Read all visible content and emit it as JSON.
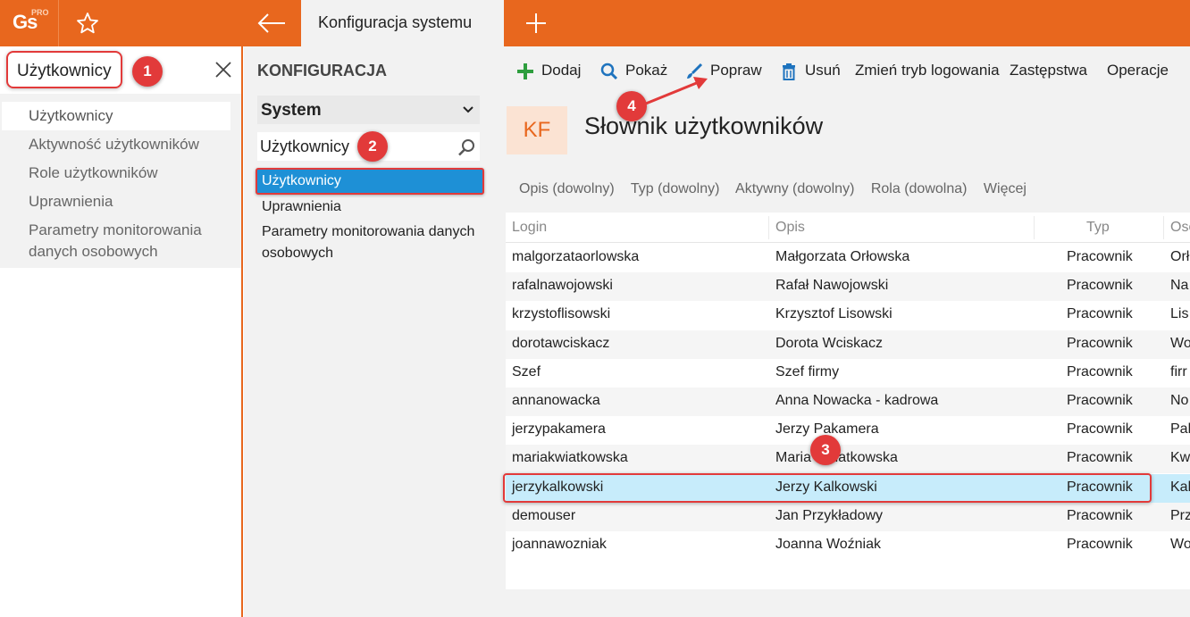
{
  "app": {
    "logo": "Gs",
    "logo_sup": "PRO",
    "tab_title": "Konfiguracja systemu"
  },
  "left": {
    "search_value": "Użytkownicy",
    "items": [
      {
        "label": "Użytkownicy"
      },
      {
        "label": "Aktywność użytkowników"
      },
      {
        "label": "Role użytkowników"
      },
      {
        "label": "Uprawnienia"
      },
      {
        "label": "Parametry monitorowania danych osobowych"
      }
    ]
  },
  "middle": {
    "title": "KONFIGURACJA",
    "select_value": "System",
    "search_value": "Użytkownicy",
    "tree": [
      {
        "label": "Użytkownicy"
      },
      {
        "label": "Uprawnienia"
      },
      {
        "label": "Parametry monitorowania danych osobowych"
      }
    ]
  },
  "toolbar": {
    "add": "Dodaj",
    "show": "Pokaż",
    "edit": "Popraw",
    "delete": "Usuń",
    "login_mode": "Zmień tryb logowania",
    "substitutions": "Zastępstwa",
    "operations": "Operacje"
  },
  "main": {
    "badge": "KF",
    "title": "Słownik użytkowników",
    "filters": [
      "Opis (dowolny)",
      "Typ (dowolny)",
      "Aktywny (dowolny)",
      "Rola (dowolna)",
      "Więcej"
    ]
  },
  "table": {
    "headers": [
      "Login",
      "Opis",
      "Typ",
      "Oso"
    ],
    "rows": [
      {
        "login": "malgorzataorlowska",
        "opis": "Małgorzata Orłowska",
        "typ": "Pracownik",
        "oso": "Orł"
      },
      {
        "login": "rafalnawojowski",
        "opis": "Rafał Nawojowski",
        "typ": "Pracownik",
        "oso": "Na"
      },
      {
        "login": "krzystoflisowski",
        "opis": "Krzysztof Lisowski",
        "typ": "Pracownik",
        "oso": "Lis"
      },
      {
        "login": "dorotawciskacz",
        "opis": "Dorota Wciskacz",
        "typ": "Pracownik",
        "oso": "Wo"
      },
      {
        "login": "Szef",
        "opis": "Szef firmy",
        "typ": "Pracownik",
        "oso": "firr"
      },
      {
        "login": "annanowacka",
        "opis": "Anna Nowacka - kadrowa",
        "typ": "Pracownik",
        "oso": "No"
      },
      {
        "login": "jerzypakamera",
        "opis": "Jerzy Pakamera",
        "typ": "Pracownik",
        "oso": "Pak"
      },
      {
        "login": "mariakwiatkowska",
        "opis": "Maria Kwiatkowska",
        "typ": "Pracownik",
        "oso": "Kw"
      },
      {
        "login": "jerzykalkowski",
        "opis": "Jerzy Kalkowski",
        "typ": "Pracownik",
        "oso": "Kal"
      },
      {
        "login": "demouser",
        "opis": "Jan Przykładowy",
        "typ": "Pracownik",
        "oso": "Prz"
      },
      {
        "login": "joannawozniak",
        "opis": "Joanna Woźniak",
        "typ": "Pracownik",
        "oso": "Wo"
      }
    ],
    "selected_index": 8
  },
  "annotations": [
    "1",
    "2",
    "3",
    "4"
  ],
  "colors": {
    "accent": "#e8671e",
    "selection_blue": "#1e90d6",
    "row_selected": "#c7ecfb",
    "annotation_red": "#e23a3a"
  }
}
